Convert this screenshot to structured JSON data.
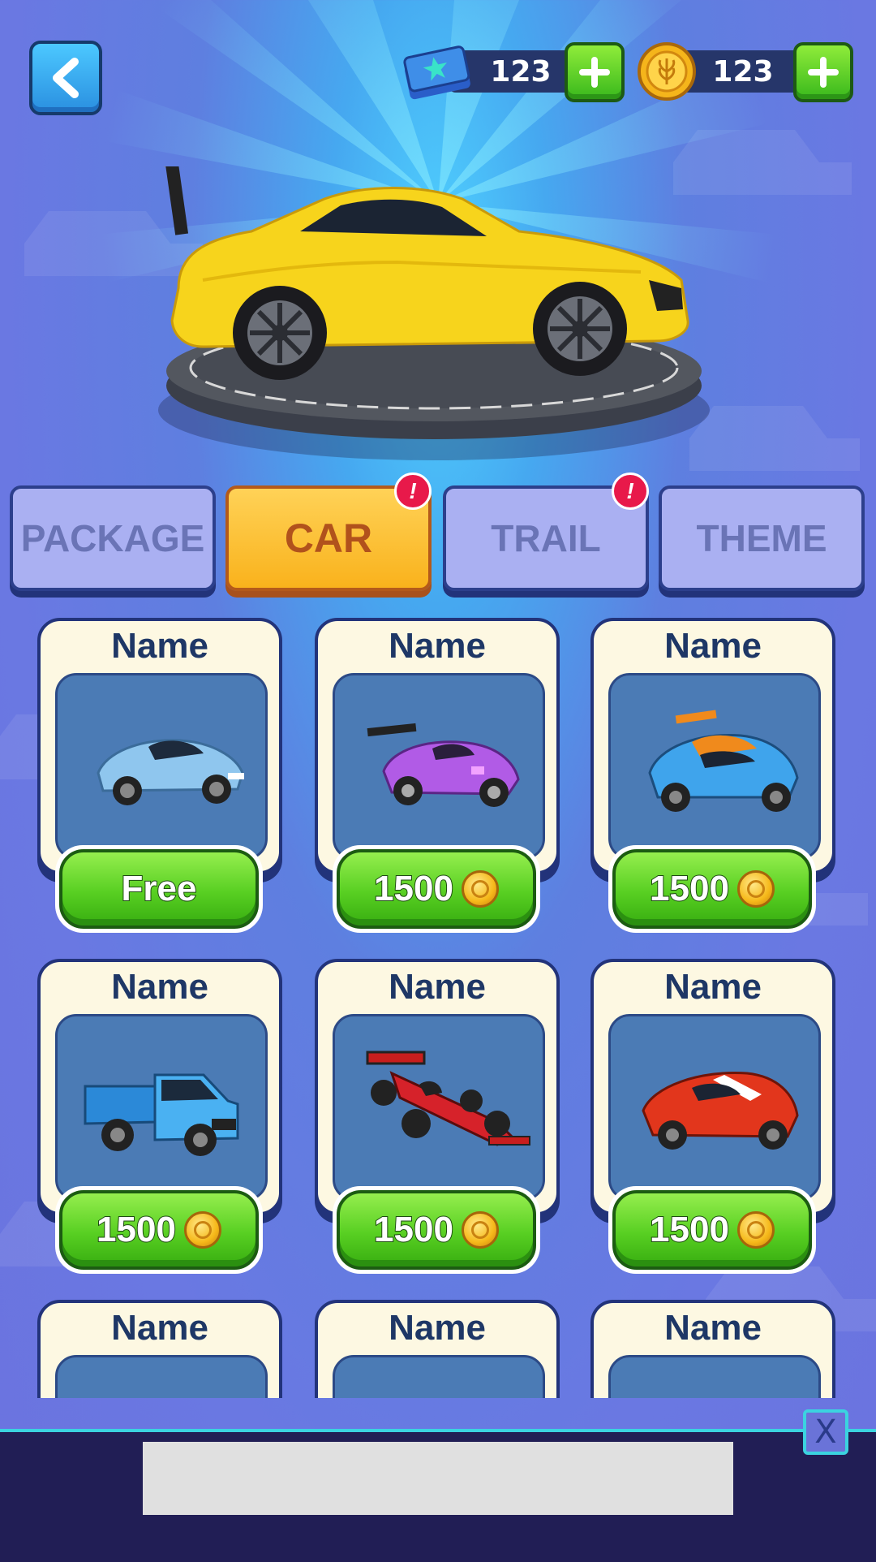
{
  "header": {
    "tickets": "123",
    "coins": "123"
  },
  "tabs": [
    {
      "label": "PACKAGE",
      "active": false,
      "alert": false
    },
    {
      "label": "CAR",
      "active": true,
      "alert": true
    },
    {
      "label": "TRAIL",
      "active": false,
      "alert": true
    },
    {
      "label": "THEME",
      "active": false,
      "alert": false
    }
  ],
  "alert_mark": "!",
  "cards": [
    {
      "name": "Name",
      "price": "Free",
      "icon": "blue-hypercar-icon"
    },
    {
      "name": "Name",
      "price": "1500",
      "icon": "purple-race-car-icon"
    },
    {
      "name": "Name",
      "price": "1500",
      "icon": "blue-orange-supercar-icon"
    },
    {
      "name": "Name",
      "price": "1500",
      "icon": "blue-pickup-truck-icon"
    },
    {
      "name": "Name",
      "price": "1500",
      "icon": "formula-car-icon"
    },
    {
      "name": "Name",
      "price": "1500",
      "icon": "red-sports-car-icon"
    },
    {
      "name": "Name",
      "price": "",
      "icon": ""
    },
    {
      "name": "Name",
      "price": "",
      "icon": ""
    },
    {
      "name": "Name",
      "price": "",
      "icon": ""
    }
  ],
  "ad": {
    "close_label": "X"
  },
  "colors": {
    "accent_green": "#58cf22",
    "tab_active": "#f9b21c",
    "hero_car": "#f6d31c",
    "alert": "#e8194a"
  }
}
